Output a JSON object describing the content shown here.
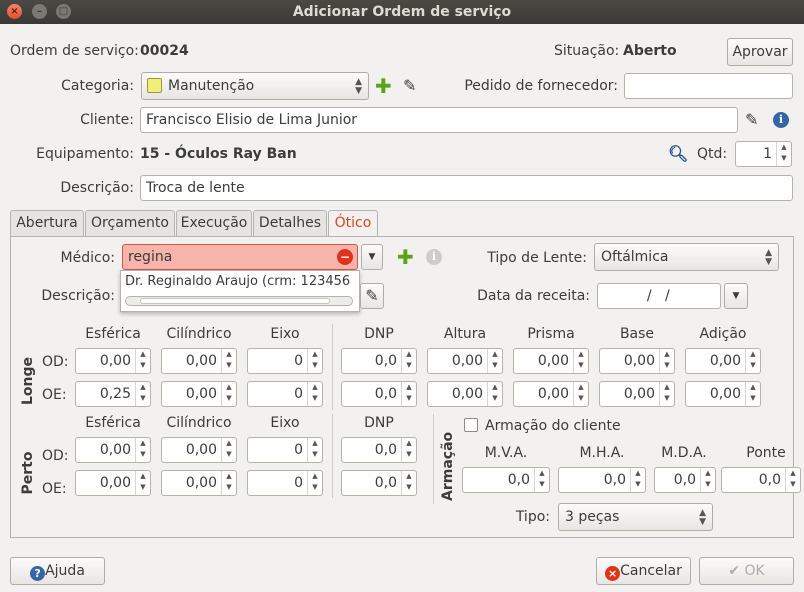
{
  "window": {
    "title": "Adicionar Ordem de serviço"
  },
  "header": {
    "os_label": "Ordem de serviço:",
    "os_number": "00024",
    "situacao_label": "Situação:",
    "situacao_value": "Aberto",
    "approve_button": "Aprovar"
  },
  "form": {
    "categoria_label": "Categoria:",
    "categoria_value": "Manutenção",
    "categoria_color": "#f0ef7a",
    "pedido_label": "Pedido de fornecedor:",
    "pedido_value": "",
    "cliente_label": "Cliente:",
    "cliente_value": "Francisco Elisio de Lima Junior",
    "equipamento_label": "Equipamento:",
    "equipamento_value": "15 - Óculos Ray Ban",
    "qtd_label": "Qtd:",
    "qtd_value": "1",
    "descricao_label": "Descrição:",
    "descricao_value": "Troca de lente"
  },
  "tabs": [
    {
      "label": "Abertura"
    },
    {
      "label": "Orçamento"
    },
    {
      "label": "Execução"
    },
    {
      "label": "Detalhes"
    },
    {
      "label": "Ótico"
    }
  ],
  "otico": {
    "medico_label": "Médico:",
    "medico_value": "regina",
    "medico_suggestion": "Dr. Reginaldo Araujo  (crm: 123456",
    "tipo_lente_label": "Tipo de Lente:",
    "tipo_lente_value": "Oftálmica",
    "descricao_label": "Descrição:",
    "data_receita_label": "Data da receita:",
    "data_receita_value": "  /   /",
    "longe_label": "Longe",
    "perto_label": "Perto",
    "armacao_label": "Armação",
    "od_label": "OD:",
    "oe_label": "OE:",
    "headers_left": [
      "Esférica",
      "Cilíndrico",
      "Eixo"
    ],
    "headers_right": [
      "DNP",
      "Altura",
      "Prisma",
      "Base",
      "Adição"
    ],
    "longe_od": [
      "0,00",
      "0,00",
      "0",
      "0,0",
      "0,00",
      "0,00",
      "0,00",
      "0,00"
    ],
    "longe_oe": [
      "0,25",
      "0,00",
      "0",
      "0,0",
      "0,00",
      "0,00",
      "0,00",
      "0,00"
    ],
    "perto_dnp_label": "DNP",
    "perto_od": [
      "0,00",
      "0,00",
      "0",
      "0,0"
    ],
    "perto_oe": [
      "0,00",
      "0,00",
      "0",
      "0,0"
    ],
    "armacao_cliente_label": "Armação do cliente",
    "armacao_headers": [
      "M.V.A.",
      "M.H.A.",
      "M.D.A.",
      "Ponte"
    ],
    "armacao_values": [
      "0,0",
      "0,0",
      "0,0",
      "0,0"
    ],
    "tipo_label": "Tipo:",
    "tipo_value": "3 peças"
  },
  "footer": {
    "help_button": "Ajuda",
    "cancel_button": "Cancelar",
    "ok_button": "OK"
  }
}
